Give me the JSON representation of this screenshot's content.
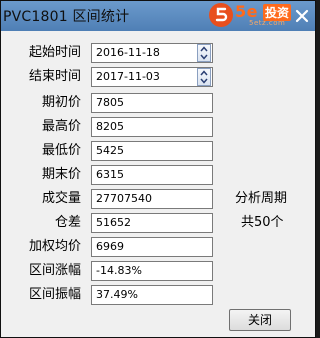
{
  "window": {
    "title": "PVC1801 区间统计",
    "close_glyph": "✕"
  },
  "watermark": {
    "brand": "5e",
    "brand_cn": "投资",
    "url": "5etz.com"
  },
  "fields": {
    "start_time": {
      "label": "起始时间",
      "value": "2016-11-18"
    },
    "end_time": {
      "label": "结束时间",
      "value": "2017-11-03"
    },
    "open_price": {
      "label": "期初价",
      "value": "7805"
    },
    "high_price": {
      "label": "最高价",
      "value": "8205"
    },
    "low_price": {
      "label": "最低价",
      "value": "5425"
    },
    "close_price": {
      "label": "期末价",
      "value": "6315"
    },
    "volume": {
      "label": "成交量",
      "value": "27707540"
    },
    "position_diff": {
      "label": "仓差",
      "value": "51652"
    },
    "weighted_avg": {
      "label": "加权均价",
      "value": "6969"
    },
    "range_change": {
      "label": "区间涨幅",
      "value": "-14.83%"
    },
    "range_amplitude": {
      "label": "区间振幅",
      "value": "37.49%"
    }
  },
  "analysis": {
    "period_label": "分析周期",
    "period_value": "共50个"
  },
  "buttons": {
    "close": "关闭"
  },
  "colors": {
    "titlebar": "#5b89bf",
    "dialog_bg": "#f0f0f0",
    "logo_orange": "#ff6a1c"
  }
}
